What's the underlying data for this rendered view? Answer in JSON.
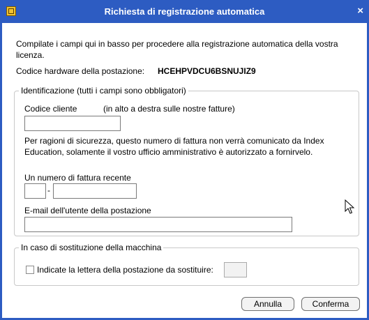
{
  "window": {
    "title": "Richiesta di registrazione automatica",
    "close_glyph": "×",
    "title_bar_color": "#2d5cc2"
  },
  "intro": "Compilate i campi qui in basso per procedere alla registrazione automatica della vostra licenza.",
  "hardware": {
    "label": "Codice hardware della postazione:",
    "value": "HCEHPVDCU6BSNUJIZ9"
  },
  "identification": {
    "legend": "Identificazione (tutti i campi sono obbligatori)",
    "client_code_label": "Codice cliente",
    "client_code_hint": "(in alto a destra sulle nostre fatture)",
    "client_code_value": "",
    "security_note": "Per ragioni di sicurezza, questo numero di fattura non verrà comunicato da Index Education, solamente il vostro ufficio amministrativo è autorizzato a fornirvelo.",
    "invoice_label": "Un numero di fattura recente",
    "invoice_prefix_value": "",
    "invoice_separator": "-",
    "invoice_number_value": "",
    "email_label": "E-mail dell'utente della postazione",
    "email_value": ""
  },
  "replacement": {
    "legend": "In caso di sostituzione della macchina",
    "checkbox_label": "Indicate la lettera della postazione da sostituire:",
    "checked": false,
    "letter_value": ""
  },
  "buttons": {
    "cancel": "Annulla",
    "confirm": "Conferma"
  },
  "icons": {
    "app": "app-icon",
    "close": "close-icon",
    "cursor": "mouse-pointer-icon"
  }
}
